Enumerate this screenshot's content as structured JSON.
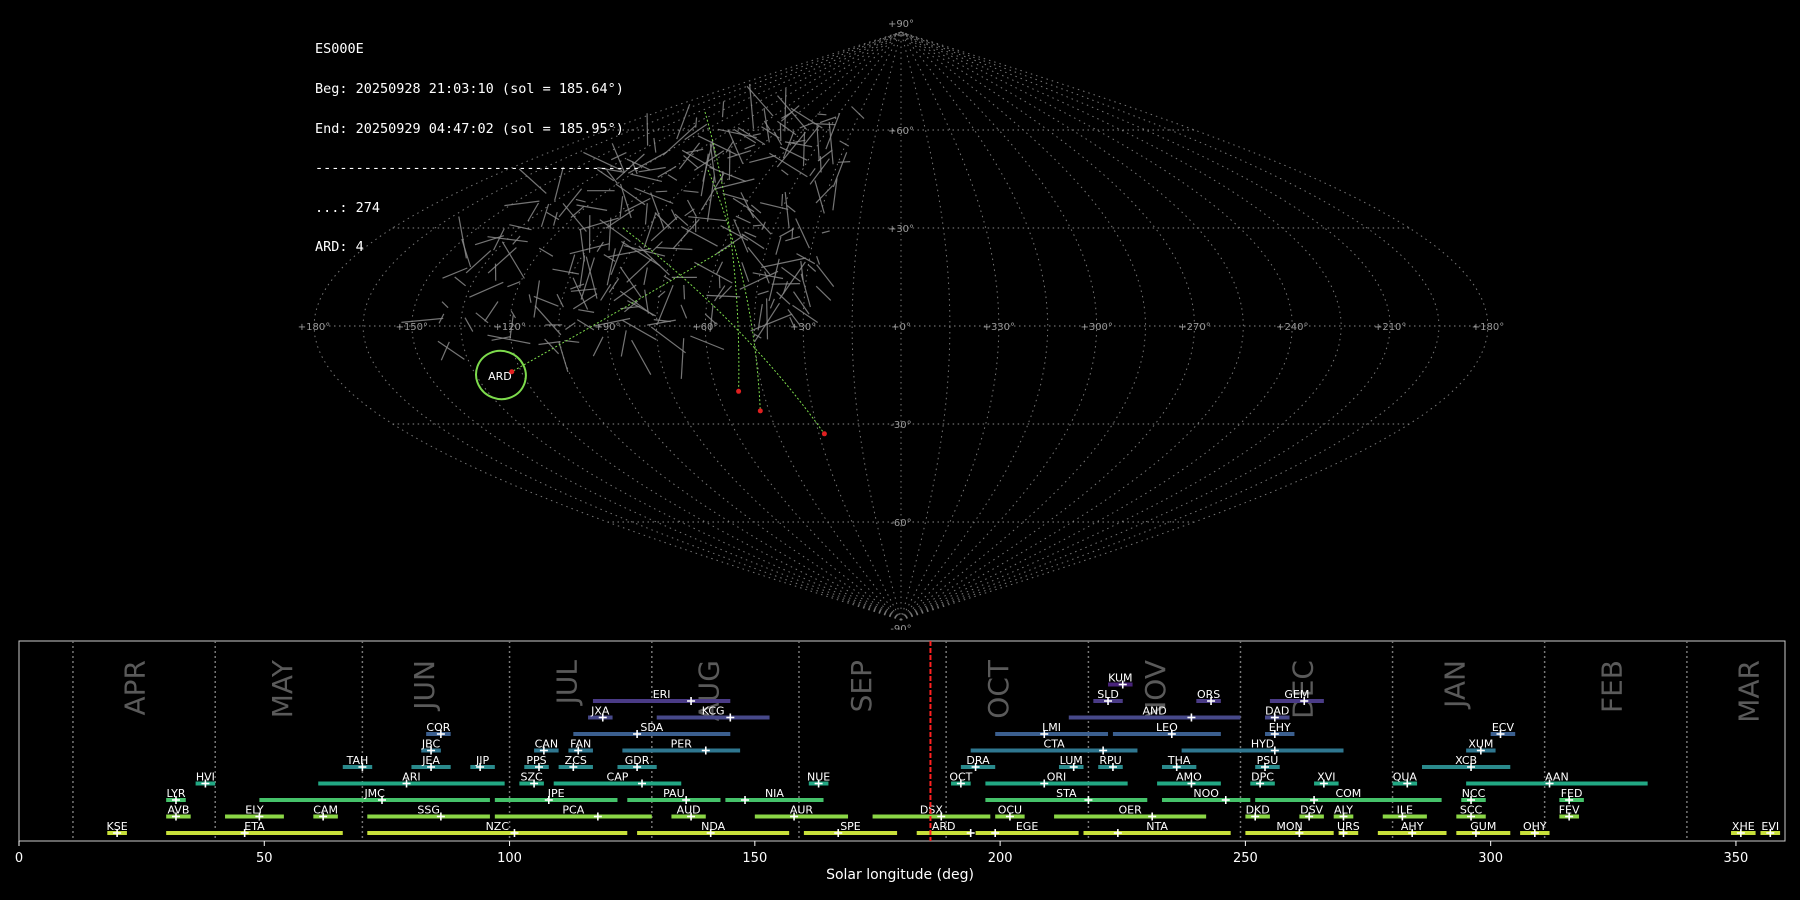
{
  "info": {
    "station": "ES000E",
    "beg": "Beg: 20250928 21:03:10 (sol = 185.64°)",
    "end": "End: 20250929 04:47:02 (sol = 185.95°)",
    "separator": "----------------------------------------",
    "sporadic_line": "...: 274",
    "shower_line": "ARD: 4"
  },
  "chart_data": [
    {
      "type": "scatter",
      "projection": "sinusoidal all-sky (radiant map)",
      "grid": "dotted",
      "lon_tick_labels": [
        "+180°",
        "+150°",
        "+120°",
        "+90°",
        "+60°",
        "+30°",
        "+0°",
        "+330°",
        "+300°",
        "+270°",
        "+240°",
        "+210°",
        "+180°"
      ],
      "lat_tick_labels": [
        "+90°",
        "+60°",
        "+30°",
        "-30°",
        "-60°",
        "-90°"
      ],
      "shower": {
        "name": "ARD",
        "lon": 127,
        "lat": -15,
        "color": "#7ddb4c"
      },
      "shower_meteor_endpoints": [
        {
          "lon": 53,
          "lat": -20
        },
        {
          "lon": 48,
          "lat": -26
        },
        {
          "lon": 28,
          "lat": -33
        },
        {
          "lon": 123,
          "lat": -14
        }
      ],
      "sporadic_count": 274
    },
    {
      "type": "timeline",
      "xlabel": "Solar longitude (deg)",
      "xlim": [
        0,
        360
      ],
      "x_ticks": [
        "0",
        "50",
        "100",
        "150",
        "200",
        "250",
        "300",
        "350"
      ],
      "months": [
        {
          "label": "APR",
          "x": 24
        },
        {
          "label": "MAY",
          "x": 54
        },
        {
          "label": "JUN",
          "x": 83
        },
        {
          "label": "JUL",
          "x": 112
        },
        {
          "label": "AUG",
          "x": 141
        },
        {
          "label": "SEP",
          "x": 172
        },
        {
          "label": "OCT",
          "x": 200
        },
        {
          "label": "NOV",
          "x": 232
        },
        {
          "label": "DEC",
          "x": 262
        },
        {
          "label": "JAN",
          "x": 293
        },
        {
          "label": "FEB",
          "x": 325
        },
        {
          "label": "MAR",
          "x": 353
        }
      ],
      "month_boundaries": [
        11,
        40,
        70,
        100,
        129,
        159,
        189,
        218,
        249,
        280,
        311,
        340
      ],
      "current_sol": 185.8,
      "showers": [
        {
          "code": "KUM",
          "start": 222,
          "end": 227,
          "peak": 225,
          "row": 9
        },
        {
          "code": "ERI",
          "start": 117,
          "end": 145,
          "peak": 137,
          "row": 8
        },
        {
          "code": "SLD",
          "start": 219,
          "end": 225,
          "peak": 222,
          "row": 8
        },
        {
          "code": "ORS",
          "start": 240,
          "end": 245,
          "peak": 243,
          "row": 8
        },
        {
          "code": "GEM",
          "start": 255,
          "end": 266,
          "peak": 262,
          "row": 8
        },
        {
          "code": "JXA",
          "start": 116,
          "end": 121,
          "peak": 119,
          "row": 7
        },
        {
          "code": "KCG",
          "start": 130,
          "end": 153,
          "peak": 145,
          "row": 7
        },
        {
          "code": "AND",
          "start": 214,
          "end": 249,
          "peak": 239,
          "row": 7
        },
        {
          "code": "DAD",
          "start": 254,
          "end": 259,
          "peak": 256,
          "row": 7
        },
        {
          "code": "COR",
          "start": 83,
          "end": 88,
          "peak": 86,
          "row": 6
        },
        {
          "code": "SDA",
          "start": 113,
          "end": 145,
          "peak": 126,
          "row": 6
        },
        {
          "code": "LMI",
          "start": 199,
          "end": 222,
          "peak": 209,
          "row": 6
        },
        {
          "code": "LEO",
          "start": 223,
          "end": 245,
          "peak": 235,
          "row": 6
        },
        {
          "code": "EHY",
          "start": 254,
          "end": 260,
          "peak": 256,
          "row": 6
        },
        {
          "code": "ECV",
          "start": 300,
          "end": 305,
          "peak": 302,
          "row": 6
        },
        {
          "code": "JBC",
          "start": 82,
          "end": 86,
          "peak": 84,
          "row": 5
        },
        {
          "code": "CAN",
          "start": 105,
          "end": 110,
          "peak": 107,
          "row": 5
        },
        {
          "code": "FAN",
          "start": 112,
          "end": 117,
          "peak": 114,
          "row": 5
        },
        {
          "code": "PER",
          "start": 123,
          "end": 147,
          "peak": 140,
          "row": 5
        },
        {
          "code": "CTA",
          "start": 194,
          "end": 228,
          "peak": 221,
          "row": 5
        },
        {
          "code": "HYD",
          "start": 237,
          "end": 270,
          "peak": 256,
          "row": 5
        },
        {
          "code": "XUM",
          "start": 295,
          "end": 301,
          "peak": 298,
          "row": 5
        },
        {
          "code": "TAH",
          "start": 66,
          "end": 72,
          "peak": 70,
          "row": 4
        },
        {
          "code": "JEA",
          "start": 80,
          "end": 88,
          "peak": 84,
          "row": 4
        },
        {
          "code": "JIP",
          "start": 92,
          "end": 97,
          "peak": 94,
          "row": 4
        },
        {
          "code": "PPS",
          "start": 103,
          "end": 108,
          "peak": 106,
          "row": 4
        },
        {
          "code": "ZCS",
          "start": 110,
          "end": 117,
          "peak": 113,
          "row": 4
        },
        {
          "code": "GDR",
          "start": 122,
          "end": 130,
          "peak": 126,
          "row": 4
        },
        {
          "code": "DRA",
          "start": 192,
          "end": 199,
          "peak": 195,
          "row": 4
        },
        {
          "code": "LUM",
          "start": 212,
          "end": 217,
          "peak": 215,
          "row": 4
        },
        {
          "code": "RPU",
          "start": 220,
          "end": 225,
          "peak": 223,
          "row": 4
        },
        {
          "code": "THA",
          "start": 233,
          "end": 240,
          "peak": 236,
          "row": 4
        },
        {
          "code": "PSU",
          "start": 252,
          "end": 257,
          "peak": 254,
          "row": 4
        },
        {
          "code": "XCB",
          "start": 286,
          "end": 304,
          "peak": 296,
          "row": 4
        },
        {
          "code": "HVI",
          "start": 36,
          "end": 40,
          "peak": 38,
          "row": 3
        },
        {
          "code": "ARI",
          "start": 61,
          "end": 99,
          "peak": 79,
          "row": 3
        },
        {
          "code": "SZC",
          "start": 102,
          "end": 107,
          "peak": 105,
          "row": 3
        },
        {
          "code": "CAP",
          "start": 109,
          "end": 135,
          "peak": 127,
          "row": 3
        },
        {
          "code": "NUE",
          "start": 161,
          "end": 165,
          "peak": 163,
          "row": 3
        },
        {
          "code": "OCT",
          "start": 190,
          "end": 194,
          "peak": 192,
          "row": 3
        },
        {
          "code": "ORI",
          "start": 197,
          "end": 226,
          "peak": 209,
          "row": 3
        },
        {
          "code": "AMO",
          "start": 232,
          "end": 245,
          "peak": 239,
          "row": 3
        },
        {
          "code": "DPC",
          "start": 251,
          "end": 256,
          "peak": 253,
          "row": 3
        },
        {
          "code": "XVI",
          "start": 264,
          "end": 269,
          "peak": 266,
          "row": 3
        },
        {
          "code": "QUA",
          "start": 280,
          "end": 285,
          "peak": 283,
          "row": 3
        },
        {
          "code": "AAN",
          "start": 295,
          "end": 332,
          "peak": 312,
          "row": 3
        },
        {
          "code": "LYR",
          "start": 30,
          "end": 34,
          "peak": 32,
          "row": 2
        },
        {
          "code": "JMC",
          "start": 49,
          "end": 96,
          "peak": 74,
          "row": 2
        },
        {
          "code": "JPE",
          "start": 97,
          "end": 122,
          "peak": 108,
          "row": 2
        },
        {
          "code": "PAU",
          "start": 124,
          "end": 143,
          "peak": 136,
          "row": 2
        },
        {
          "code": "NIA",
          "start": 144,
          "end": 164,
          "peak": 148,
          "row": 2
        },
        {
          "code": "STA",
          "start": 197,
          "end": 230,
          "peak": 218,
          "row": 2
        },
        {
          "code": "NOO",
          "start": 233,
          "end": 251,
          "peak": 246,
          "row": 2
        },
        {
          "code": "COM",
          "start": 252,
          "end": 290,
          "peak": 264,
          "row": 2
        },
        {
          "code": "NCC",
          "start": 294,
          "end": 299,
          "peak": 296,
          "row": 2
        },
        {
          "code": "FED",
          "start": 314,
          "end": 319,
          "peak": 316,
          "row": 2
        },
        {
          "code": "AVB",
          "start": 30,
          "end": 35,
          "peak": 32,
          "row": 1
        },
        {
          "code": "ELY",
          "start": 42,
          "end": 54,
          "peak": 49,
          "row": 1
        },
        {
          "code": "CAM",
          "start": 60,
          "end": 65,
          "peak": 62,
          "row": 1
        },
        {
          "code": "SSG",
          "start": 71,
          "end": 96,
          "peak": 86,
          "row": 1
        },
        {
          "code": "PCA",
          "start": 97,
          "end": 129,
          "peak": 118,
          "row": 1
        },
        {
          "code": "AUD",
          "start": 133,
          "end": 140,
          "peak": 137,
          "row": 1
        },
        {
          "code": "AUR",
          "start": 150,
          "end": 169,
          "peak": 158,
          "row": 1
        },
        {
          "code": "DSX",
          "start": 174,
          "end": 198,
          "peak": 188,
          "row": 1
        },
        {
          "code": "OCU",
          "start": 199,
          "end": 205,
          "peak": 202,
          "row": 1
        },
        {
          "code": "OER",
          "start": 211,
          "end": 242,
          "peak": 231,
          "row": 1
        },
        {
          "code": "DKD",
          "start": 250,
          "end": 255,
          "peak": 252,
          "row": 1
        },
        {
          "code": "DSV",
          "start": 261,
          "end": 266,
          "peak": 263,
          "row": 1
        },
        {
          "code": "ALY",
          "start": 268,
          "end": 272,
          "peak": 270,
          "row": 1
        },
        {
          "code": "ILE",
          "start": 278,
          "end": 287,
          "peak": 282,
          "row": 1
        },
        {
          "code": "SCC",
          "start": 293,
          "end": 299,
          "peak": 296,
          "row": 1
        },
        {
          "code": "FEV",
          "start": 314,
          "end": 318,
          "peak": 316,
          "row": 1
        },
        {
          "code": "KSE",
          "start": 18,
          "end": 22,
          "peak": 20,
          "row": 0
        },
        {
          "code": "ETA",
          "start": 30,
          "end": 66,
          "peak": 46,
          "row": 0
        },
        {
          "code": "NZC",
          "start": 71,
          "end": 124,
          "peak": 101,
          "row": 0
        },
        {
          "code": "NDA",
          "start": 126,
          "end": 157,
          "peak": 141,
          "row": 0
        },
        {
          "code": "SPE",
          "start": 160,
          "end": 179,
          "peak": 167,
          "row": 0
        },
        {
          "code": "ARD",
          "start": 183,
          "end": 194,
          "peak": 194,
          "row": 0
        },
        {
          "code": "EGE",
          "start": 195,
          "end": 216,
          "peak": 199,
          "row": 0
        },
        {
          "code": "NTA",
          "start": 217,
          "end": 247,
          "peak": 224,
          "row": 0
        },
        {
          "code": "MON",
          "start": 250,
          "end": 268,
          "peak": 261,
          "row": 0
        },
        {
          "code": "URS",
          "start": 269,
          "end": 273,
          "peak": 270,
          "row": 0
        },
        {
          "code": "AHY",
          "start": 277,
          "end": 291,
          "peak": 284,
          "row": 0
        },
        {
          "code": "GUM",
          "start": 293,
          "end": 304,
          "peak": 297,
          "row": 0
        },
        {
          "code": "OHY",
          "start": 306,
          "end": 312,
          "peak": 309,
          "row": 0
        },
        {
          "code": "XHE",
          "start": 349,
          "end": 354,
          "peak": 351,
          "row": 0
        },
        {
          "code": "EVI",
          "start": 355,
          "end": 359,
          "peak": 357,
          "row": 0
        }
      ]
    }
  ]
}
